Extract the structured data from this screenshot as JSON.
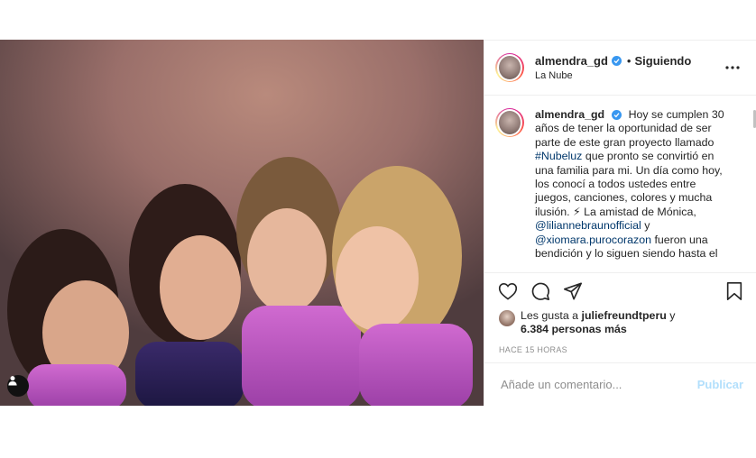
{
  "post": {
    "username": "almendra_gd",
    "dot": "•",
    "following_label": "Siguiendo",
    "location": "La Nube",
    "caption": {
      "username": "almendra_gd",
      "text_1": "Hoy se cumplen 30 años de tener la oportunidad de ser parte de este gran proyecto llamado",
      "hashtag": "#Nubeluz",
      "text_2": "que pronto se convirtió en una familia para mi. Un día como hoy, los conocí a todos ustedes entre juegos, canciones, colores y mucha ilusión. ⚡ La amistad de Mónica,",
      "mention_1": "@liliannebraunofficial",
      "text_3": "y",
      "mention_2": "@xiomara.purocorazon",
      "text_4": "fueron una bendición y lo siguen siendo hasta el"
    },
    "likes": {
      "prefix": "Les gusta a",
      "user": "juliefreundtperu",
      "connector": "y",
      "others": "6.384 personas más"
    },
    "timestamp": "HACE 15 HORAS",
    "comment": {
      "placeholder": "Añade un comentario...",
      "publish_label": "Publicar"
    }
  },
  "icons": {
    "more": "more-horizontal-icon",
    "like": "heart-icon",
    "comment": "comment-icon",
    "share": "share-icon",
    "save": "bookmark-icon",
    "tag": "user-tag-icon",
    "verified": "verified-badge-icon"
  },
  "colors": {
    "verified": "#3897f0",
    "link": "#00376b",
    "publish_disabled": "#b2dffc",
    "muted": "#8e8e8e"
  }
}
